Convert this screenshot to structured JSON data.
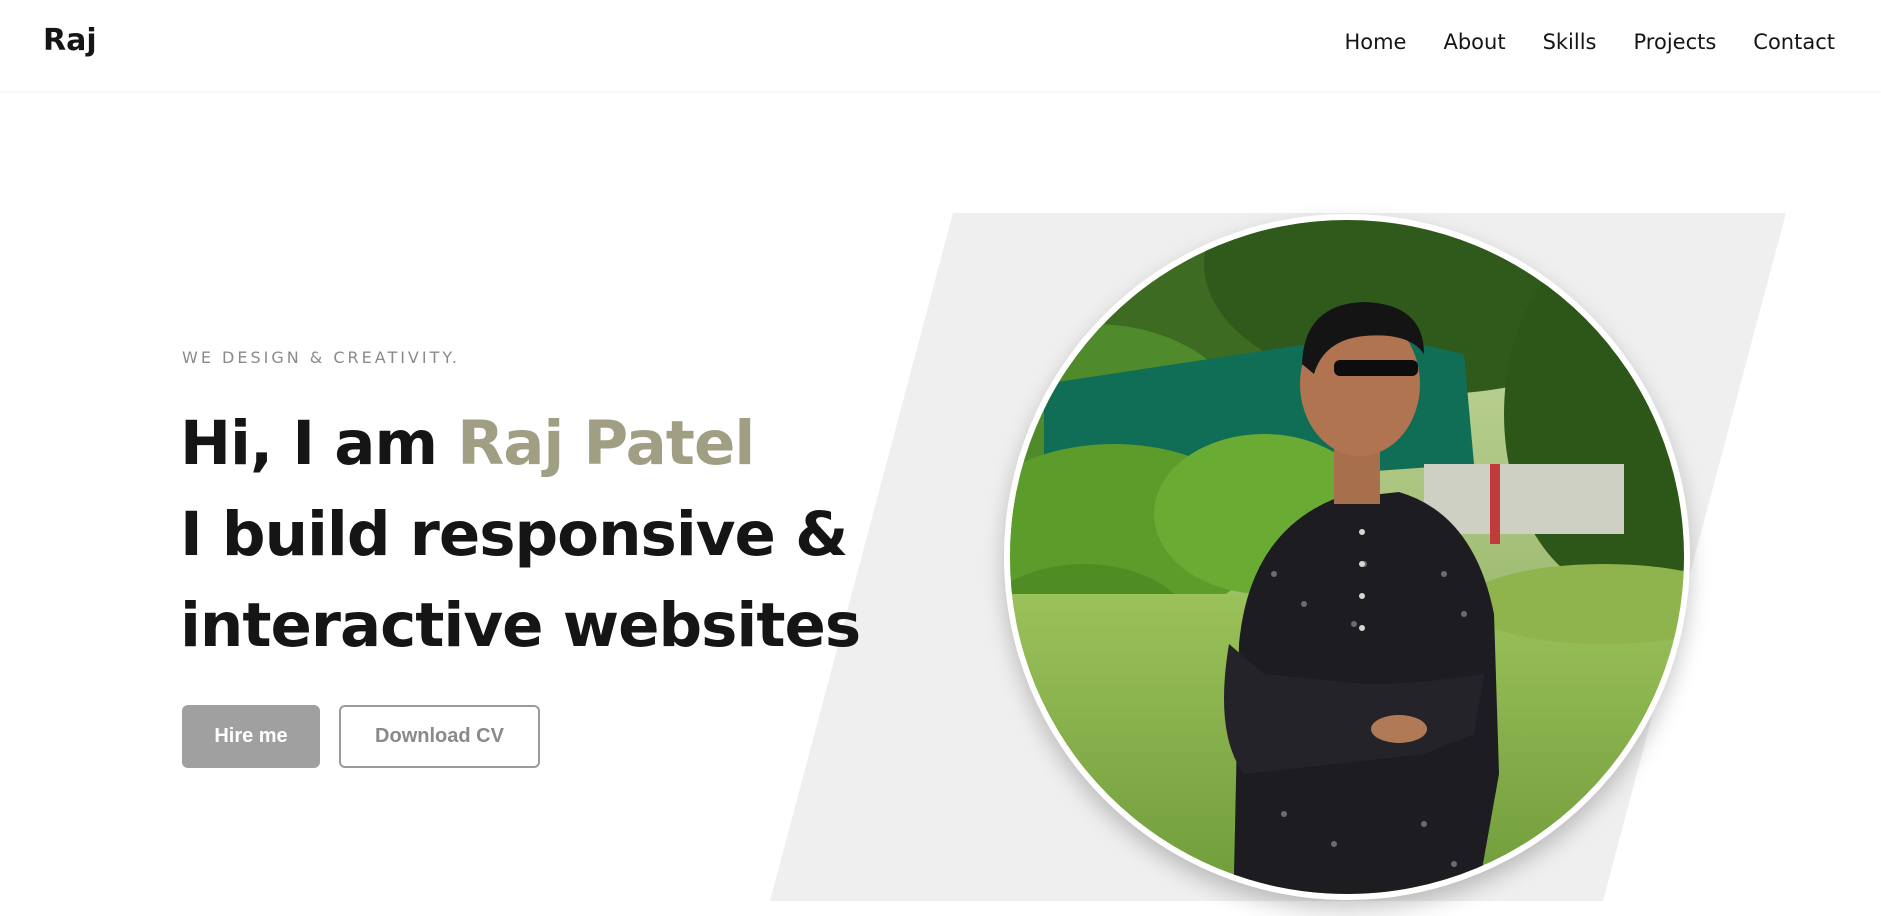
{
  "navbar": {
    "logo": "Raj",
    "links": [
      {
        "label": "Home"
      },
      {
        "label": "About"
      },
      {
        "label": "Skills"
      },
      {
        "label": "Projects"
      },
      {
        "label": "Contact"
      }
    ]
  },
  "hero": {
    "tagline": "WE DESIGN & CREATIVITY.",
    "greeting": "Hi, I am",
    "name": "Raj Patel",
    "line2": "I build responsive &",
    "line3": "interactive websites",
    "buttons": {
      "hire_label": "Hire me",
      "download_label": "Download CV"
    }
  },
  "colors": {
    "accent": "#a09f84",
    "primary_button": "#a0a0a0",
    "background_shape": "#efefef",
    "text": "#151515"
  },
  "icons": {
    "avatar": "profile-photo"
  }
}
